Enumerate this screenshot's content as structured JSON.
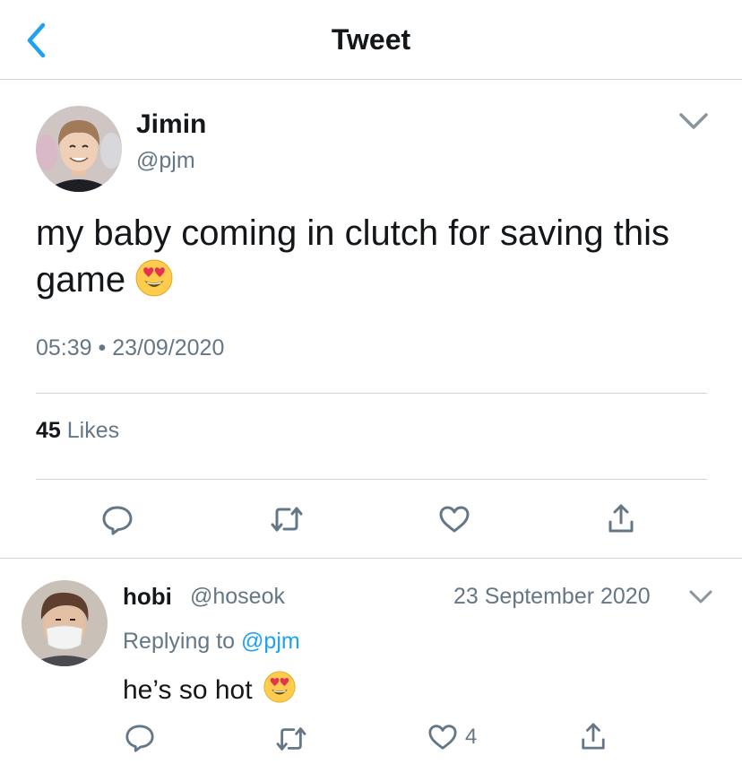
{
  "nav": {
    "title": "Tweet",
    "back_icon": "chevron-left-icon"
  },
  "tweet": {
    "author_name": "Jimin",
    "author_handle": "@pjm",
    "text": "my baby coming in clutch for saving this game",
    "emoji": "smiling-face-with-heart-eyes",
    "time": "05:39",
    "separator": "•",
    "date": "23/09/2020",
    "likes_count": "45",
    "likes_label": "Likes"
  },
  "reply": {
    "author_name": "hobi",
    "author_handle": "@hoseok",
    "date": "23 September 2020",
    "replying_to_label": "Replying to",
    "replying_to_handle": "@pjm",
    "text": "he’s so hot",
    "emoji": "smiling-face-with-heart-eyes",
    "like_count": "4"
  },
  "colors": {
    "accent": "#1da1f2",
    "text": "#14171a",
    "muted": "#657786",
    "divider": "#cfd3d6"
  },
  "icons": [
    "comment-icon",
    "retweet-icon",
    "heart-icon",
    "share-icon",
    "chevron-down-icon"
  ]
}
